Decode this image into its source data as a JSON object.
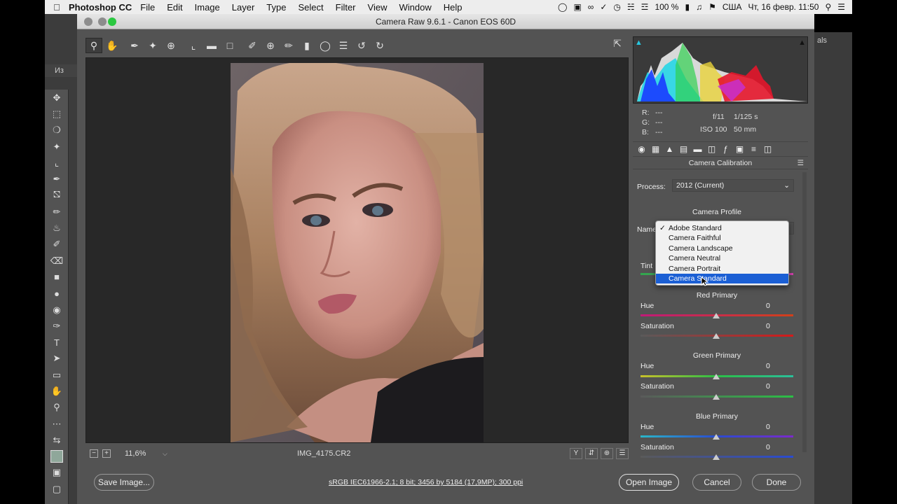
{
  "menubar": {
    "app_name": "Photoshop CC",
    "items": [
      "File",
      "Edit",
      "Image",
      "Layer",
      "Type",
      "Select",
      "Filter",
      "View",
      "Window",
      "Help"
    ],
    "battery": "100 %",
    "language": "США",
    "datetime": "Чт, 16 февр.  11:50"
  },
  "photoshop": {
    "doc_tab": "Из",
    "right_panel_label": "als"
  },
  "dialog": {
    "title": "Camera Raw 9.6.1  -  Canon EOS 60D"
  },
  "info": {
    "r_label": "R:",
    "r_val": "---",
    "g_label": "G:",
    "g_val": "---",
    "b_label": "B:",
    "b_val": "---",
    "aperture": "f/11",
    "shutter": "1/125 s",
    "iso": "ISO 100",
    "focal": "50 mm"
  },
  "panel": {
    "title": "Camera Calibration",
    "process_label": "Process:",
    "process_value": "2012 (Current)",
    "camera_profile_title": "Camera Profile",
    "name_label": "Name",
    "tint_label": "Tint",
    "profiles": [
      "Adobe Standard",
      "Camera Faithful",
      "Camera Landscape",
      "Camera Neutral",
      "Camera Portrait",
      "Camera Standard"
    ],
    "profile_checked": "Adobe Standard",
    "profile_highlighted": "Camera Standard",
    "red_primary": {
      "title": "Red Primary",
      "hue_label": "Hue",
      "hue_value": "0",
      "sat_label": "Saturation",
      "sat_value": "0"
    },
    "green_primary": {
      "title": "Green Primary",
      "hue_label": "Hue",
      "hue_value": "0",
      "sat_label": "Saturation",
      "sat_value": "0"
    },
    "blue_primary": {
      "title": "Blue Primary",
      "hue_label": "Hue",
      "hue_value": "0",
      "sat_label": "Saturation",
      "sat_value": "0"
    }
  },
  "status": {
    "zoom": "11,6%",
    "filename": "IMG_4175.CR2",
    "view_y": "Y"
  },
  "bottom": {
    "save_image": "Save Image...",
    "workflow": "sRGB IEC61966-2.1; 8 bit; 3456 by 5184 (17,9MP); 300 ppi",
    "open_image": "Open Image",
    "cancel": "Cancel",
    "done": "Done"
  },
  "icons": {
    "toolbar": [
      "zoom-icon",
      "hand-icon",
      "white-balance-icon",
      "color-sampler-icon",
      "targeted-adjustment-icon",
      "crop-icon",
      "straighten-icon",
      "transform-icon",
      "spot-removal-icon",
      "red-eye-icon",
      "adjustment-brush-icon",
      "graduated-filter-icon",
      "radial-filter-icon",
      "preferences-icon",
      "rotate-left-icon",
      "rotate-right-icon"
    ]
  },
  "colors": {
    "dialog_bg": "#535353",
    "preview_bg": "#282828",
    "selection_blue": "#1b5fd4"
  }
}
